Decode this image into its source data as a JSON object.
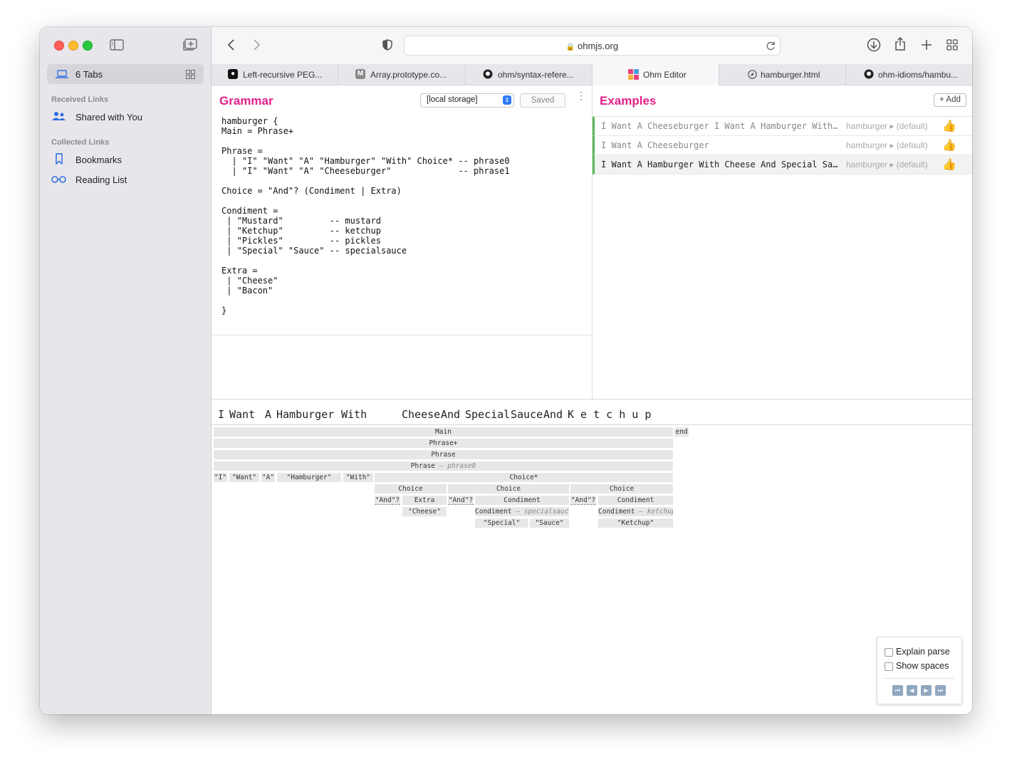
{
  "sidebar": {
    "tab_group_label": "6 Tabs",
    "received_links_header": "Received Links",
    "shared_with_you": "Shared with You",
    "collected_links_header": "Collected Links",
    "bookmarks": "Bookmarks",
    "reading_list": "Reading List"
  },
  "toolbar": {
    "url": "ohmjs.org"
  },
  "tabs": [
    {
      "title": "Left-recursive PEG..."
    },
    {
      "title": "Array.prototype.co..."
    },
    {
      "title": "ohm/syntax-refere..."
    },
    {
      "title": "Ohm Editor"
    },
    {
      "title": "hamburger.html"
    },
    {
      "title": "ohm-idioms/hambu..."
    }
  ],
  "grammar": {
    "title": "Grammar",
    "storage_select": "[local storage]",
    "saved_label": "Saved",
    "code": "hamburger {\nMain = Phrase+\n\nPhrase =\n  | \"I\" \"Want\" \"A\" \"Hamburger\" \"With\" Choice* -- phrase0\n  | \"I\" \"Want\" \"A\" \"Cheeseburger\"             -- phrase1\n\nChoice = \"And\"? (Condiment | Extra)\n\nCondiment =\n | \"Mustard\"         -- mustard\n | \"Ketchup\"         -- ketchup\n | \"Pickles\"         -- pickles\n | \"Special\" \"Sauce\" -- specialsauce\n\nExtra =\n | \"Cheese\"\n | \"Bacon\"\n\n}"
  },
  "examples": {
    "title": "Examples",
    "add_label": "+ Add",
    "items": [
      {
        "text": "I Want A Cheeseburger I Want A Hamburger With…",
        "rule": "hamburger ▸ (default)",
        "passing": true
      },
      {
        "text": "I Want A Cheeseburger",
        "rule": "hamburger ▸ (default)",
        "passing": true
      },
      {
        "text": "I Want A Hamburger With Cheese And Special Sa…",
        "rule": "hamburger ▸ (default)",
        "passing": true
      }
    ]
  },
  "input_tokens": [
    "I",
    "Want",
    "A",
    "Hamburger",
    "With",
    "Cheese",
    "And",
    "Special",
    "Sauce",
    "And",
    "K e t c h u p"
  ],
  "parse_tree": {
    "main": "Main",
    "end": "end",
    "phrase_plus": "Phrase+",
    "phrase": "Phrase",
    "phrase_case_rule": "Phrase",
    "phrase_case": "phrase0",
    "case_sep": "–",
    "terminals": [
      "\"I\"",
      "\"Want\"",
      "\"A\"",
      "\"Hamburger\"",
      "\"With\""
    ],
    "choice_star": "Choice*",
    "choices": [
      {
        "label": "Choice",
        "and": "\"And\"?",
        "child": "Extra",
        "grandchild": "\"Cheese\""
      },
      {
        "label": "Choice",
        "and": "\"And\"?",
        "child": "Condiment",
        "grandchild_rule": "Condiment",
        "grandchild_case": "specialsauce",
        "leaves": [
          "\"Special\"",
          "\"Sauce\""
        ]
      },
      {
        "label": "Choice",
        "and": "\"And\"?",
        "child": "Condiment",
        "grandchild_rule": "Condiment",
        "grandchild_case": "ketchup",
        "leaves": [
          "\"Ketchup\""
        ]
      }
    ]
  },
  "controls": {
    "explain_parse": "Explain parse",
    "show_spaces": "Show spaces"
  }
}
